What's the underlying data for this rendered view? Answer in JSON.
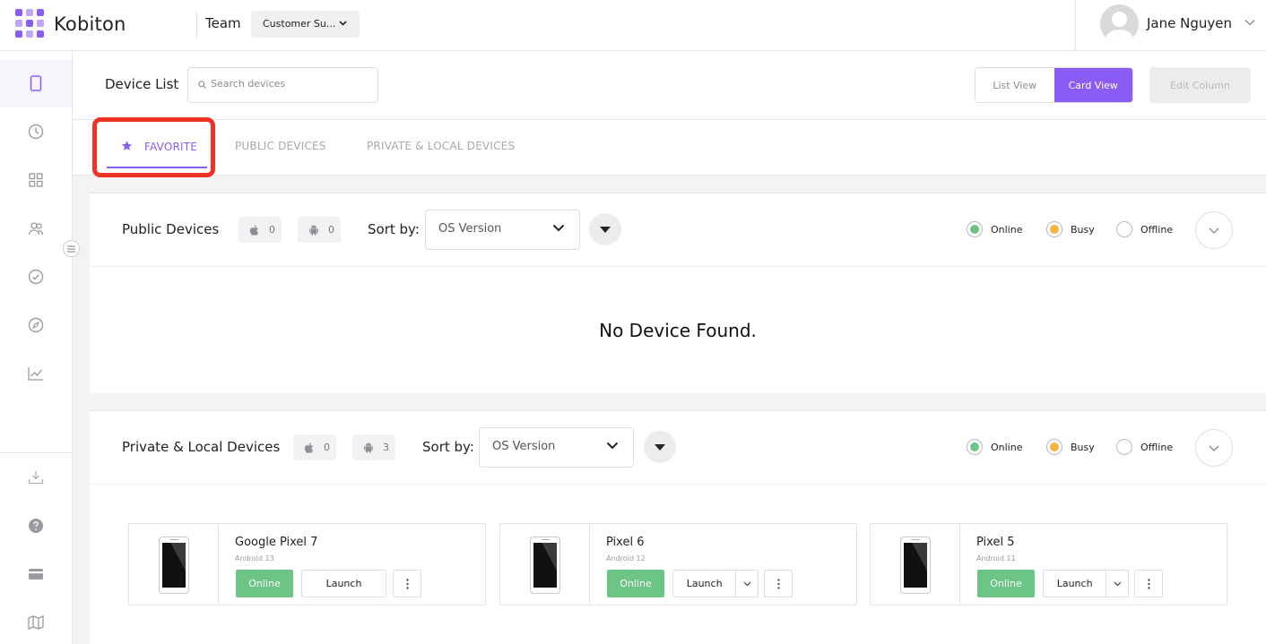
{
  "app": {
    "name": "Kobiton",
    "brand_color": "#8b5cf6"
  },
  "header": {
    "team_label": "Team",
    "team_value": "Customer Su...",
    "user_name": "Jane Nguyen"
  },
  "sidebar": {
    "items": [
      {
        "icon": "device-icon",
        "active": true
      },
      {
        "icon": "history-icon"
      },
      {
        "icon": "apps-grid-icon"
      },
      {
        "icon": "team-icon"
      },
      {
        "icon": "check-circle-icon"
      },
      {
        "icon": "compass-icon"
      },
      {
        "icon": "analytics-icon"
      }
    ],
    "bottom_items": [
      {
        "icon": "download-icon"
      },
      {
        "icon": "help-icon"
      },
      {
        "icon": "billing-icon"
      },
      {
        "icon": "map-icon"
      }
    ]
  },
  "toolbar": {
    "title": "Device List",
    "search_placeholder": "Search devices",
    "list_view": "List View",
    "card_view": "Card View",
    "edit_column": "Edit Column"
  },
  "tabs": [
    {
      "label": "FAVORITE",
      "active": true
    },
    {
      "label": "PUBLIC DEVICES"
    },
    {
      "label": "PRIVATE & LOCAL DEVICES"
    }
  ],
  "public_panel": {
    "title": "Public Devices",
    "ios_count": "0",
    "android_count": "0",
    "sort_label": "Sort by:",
    "sort_value": "OS Version",
    "status": {
      "online": "Online",
      "busy": "Busy",
      "offline": "Offline"
    },
    "empty_message": "No Device Found."
  },
  "private_panel": {
    "title": "Private & Local Devices",
    "ios_count": "0",
    "android_count": "3",
    "sort_label": "Sort by:",
    "sort_value": "OS Version",
    "status": {
      "online": "Online",
      "busy": "Busy",
      "offline": "Offline"
    }
  },
  "devices": [
    {
      "name": "Google Pixel 7",
      "os": "Android 13",
      "status": "Online",
      "action": "Launch",
      "has_dropdown": false
    },
    {
      "name": "Pixel 6",
      "os": "Android 12",
      "status": "Online",
      "action": "Launch",
      "has_dropdown": true
    },
    {
      "name": "Pixel 5",
      "os": "Android 11",
      "status": "Online",
      "action": "Launch",
      "has_dropdown": true
    }
  ],
  "colors": {
    "online": "#6cc584",
    "busy": "#f5b53f",
    "highlight": "#ee3325"
  }
}
